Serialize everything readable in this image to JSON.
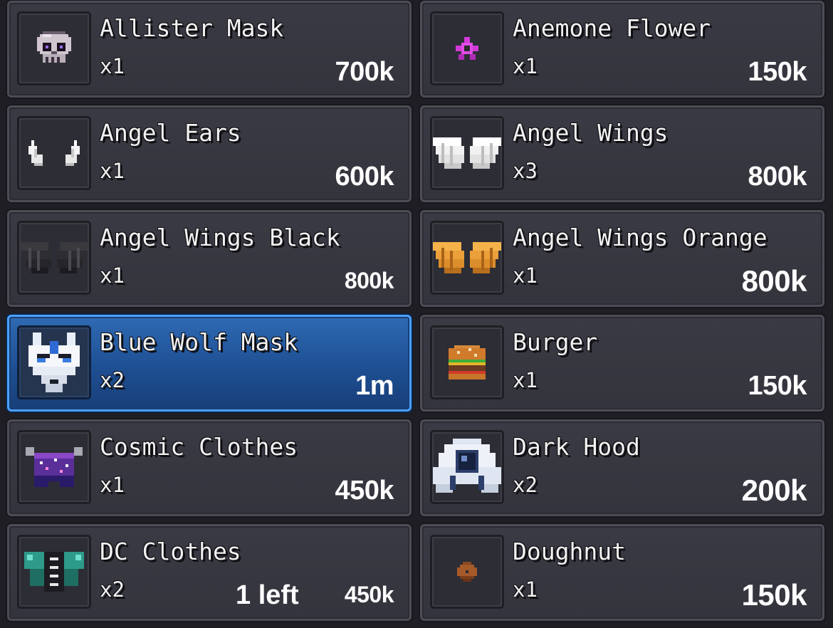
{
  "items": [
    {
      "name": "Allister Mask",
      "qty": "x1",
      "price": "700k",
      "icon": "skull-mask-icon"
    },
    {
      "name": "Anemone Flower",
      "qty": "x1",
      "price": "150k",
      "icon": "flower-icon"
    },
    {
      "name": "Angel Ears",
      "qty": "x1",
      "price": "600k",
      "icon": "angel-ears-icon"
    },
    {
      "name": "Angel Wings",
      "qty": "x3",
      "price": "800k",
      "icon": "white-wings-icon"
    },
    {
      "name": "Angel Wings Black",
      "qty": "x1",
      "price": "800k",
      "icon": "black-wings-icon"
    },
    {
      "name": "Angel Wings Orange",
      "qty": "x1",
      "price": "800k",
      "icon": "orange-wings-icon"
    },
    {
      "name": "Blue Wolf Mask",
      "qty": "x2",
      "price": "1m",
      "icon": "wolf-mask-icon",
      "selected": true
    },
    {
      "name": "Burger",
      "qty": "x1",
      "price": "150k",
      "icon": "burger-icon"
    },
    {
      "name": "Cosmic Clothes",
      "qty": "x1",
      "price": "450k",
      "icon": "cosmic-clothes-icon"
    },
    {
      "name": "Dark Hood",
      "qty": "x2",
      "price": "200k",
      "icon": "dark-hood-icon"
    },
    {
      "name": "DC Clothes",
      "qty": "x2",
      "price": "450k",
      "note": "1 left",
      "icon": "dc-clothes-icon"
    },
    {
      "name": "Doughnut",
      "qty": "x1",
      "price": "150k",
      "icon": "doughnut-icon"
    }
  ],
  "colors": {
    "card_bg": "#3a3a44",
    "selected_bg": "#1e4f93",
    "selected_border": "#4aa0ff",
    "text": "#f2f2f2"
  }
}
